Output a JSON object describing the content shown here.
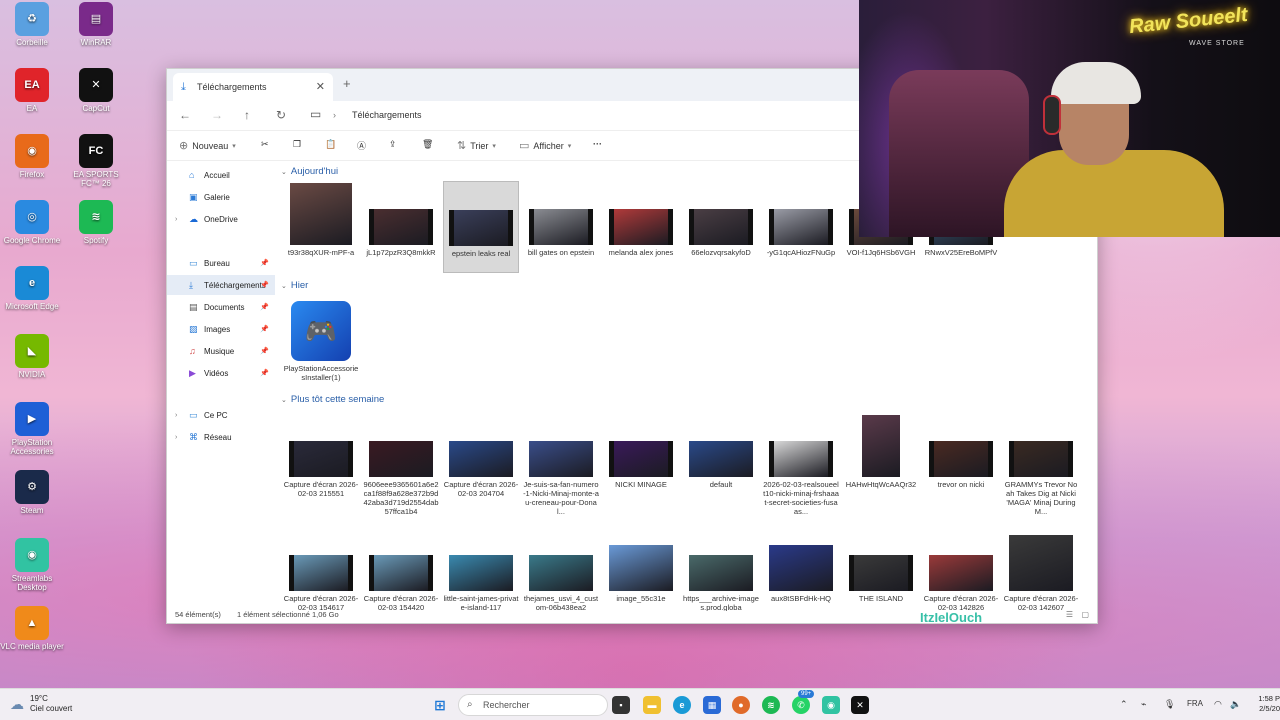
{
  "desktop": {
    "icons": [
      {
        "label": "Corbeille",
        "icon": "recycle-bin-icon"
      },
      {
        "label": "WinRAR",
        "icon": "winrar-icon"
      },
      {
        "label": "EA",
        "icon": "ea-icon"
      },
      {
        "label": "CapCut",
        "icon": "capcut-icon"
      },
      {
        "label": "Firefox",
        "icon": "firefox-icon"
      },
      {
        "label": "EA SPORTS FC™ 26",
        "icon": "easports-fc-icon"
      },
      {
        "label": "Google Chrome",
        "icon": "chrome-icon"
      },
      {
        "label": "Spotify",
        "icon": "spotify-icon"
      },
      {
        "label": "Microsoft Edge",
        "icon": "edge-icon"
      },
      {
        "label": "NVIDIA",
        "icon": "nvidia-icon"
      },
      {
        "label": "PlayStation Accessories",
        "icon": "playstation-accessories-icon"
      },
      {
        "label": "Steam",
        "icon": "steam-icon"
      },
      {
        "label": "Streamlabs Desktop",
        "icon": "streamlabs-icon"
      },
      {
        "label": "VLC media player",
        "icon": "vlc-icon"
      }
    ]
  },
  "explorer": {
    "tab_title": "Téléchargements",
    "breadcrumb": "Téléchargements",
    "toolbar": {
      "new_label": "Nouveau",
      "sort_label": "Trier",
      "view_label": "Afficher",
      "more_label": "···"
    },
    "sidebar": [
      {
        "label": "Accueil",
        "icon": "home-icon"
      },
      {
        "label": "Galerie",
        "icon": "gallery-icon"
      },
      {
        "label": "OneDrive",
        "icon": "onedrive-icon"
      },
      {
        "label": "Bureau",
        "icon": "desktop-folder-icon"
      },
      {
        "label": "Téléchargements",
        "icon": "download-icon"
      },
      {
        "label": "Documents",
        "icon": "documents-icon"
      },
      {
        "label": "Images",
        "icon": "images-icon"
      },
      {
        "label": "Musique",
        "icon": "music-icon"
      },
      {
        "label": "Vidéos",
        "icon": "videos-icon"
      },
      {
        "label": "Ce PC",
        "icon": "pc-icon"
      },
      {
        "label": "Réseau",
        "icon": "network-icon"
      }
    ],
    "groups": {
      "today": "Aujourd'hui",
      "yesterday": "Hier",
      "earlier": "Plus tôt cette semaine"
    },
    "files_today": [
      {
        "name": "t93r38qXUR-mPF-a",
        "kind": "image",
        "color": "#6a4a44"
      },
      {
        "name": "jL1p72pzR3Q8mkkR",
        "kind": "video",
        "color": "#4a2e30"
      },
      {
        "name": "epstein leaks real",
        "kind": "video",
        "color": "#3a3f5a"
      },
      {
        "name": "bill gates on epstein",
        "kind": "video",
        "color": "#8a8c92"
      },
      {
        "name": "melanda alex jones",
        "kind": "video",
        "color": "#b03a3a"
      },
      {
        "name": "66elozvqrsakyfoD",
        "kind": "video",
        "color": "#4a3e44"
      },
      {
        "name": "-yG1qcAHiozFNuGp",
        "kind": "video",
        "color": "#9a9ca6"
      },
      {
        "name": "VOI-f1Jq6HSb6VGH",
        "kind": "video",
        "color": "#6a4a3c"
      },
      {
        "name": "RNwxV25EreBoMPfV",
        "kind": "video",
        "color": "#3a5a7a"
      }
    ],
    "files_yesterday": [
      {
        "name": "PlayStationAccessoriesInstaller(1)",
        "kind": "app",
        "color": "#1e5fd6"
      }
    ],
    "files_earlier_row1": [
      {
        "name": "Capture d'écran 2026-02-03 215551",
        "kind": "video",
        "color": "#2a2a3a"
      },
      {
        "name": "9606eee9365601a6e2ca1f88f9a628e372b9d42aba3d719d2554dab57ffca1b4",
        "kind": "image",
        "color": "#3a1a22"
      },
      {
        "name": "Capture d'écran 2026-02-03 204704",
        "kind": "image",
        "color": "#2a4a8a"
      },
      {
        "name": "Je-suis-sa-fan-numero-1-Nicki-Minaj-monte-au-creneau-pour-Donal...",
        "kind": "image",
        "color": "#3a4e8a"
      },
      {
        "name": "NICKI MINAGE",
        "kind": "video",
        "color": "#3a1a5a"
      },
      {
        "name": "default",
        "kind": "image",
        "color": "#2a4a8a"
      },
      {
        "name": "2026-02-03-realsoueelt10-nicki-minaj-frshaaat-secret-societies-fusaas...",
        "kind": "video",
        "color": "#d8d8d8"
      },
      {
        "name": "HAHwHtqWcAAQr32",
        "kind": "image",
        "color": "#5a3a4a"
      },
      {
        "name": "trevor on nicki",
        "kind": "video",
        "color": "#4a2a22"
      },
      {
        "name": "GRAMMYs Trevor Noah Takes Dig at Nicki 'MAGA' Minaj During M...",
        "kind": "video",
        "color": "#3a2a22"
      }
    ],
    "files_earlier_row2": [
      {
        "name": "Capture d'écran 2026-02-03 154617",
        "kind": "video",
        "color": "#6a9ab8"
      },
      {
        "name": "Capture d'écran 2026-02-03 154420",
        "kind": "video",
        "color": "#6a9ab8"
      },
      {
        "name": "little-saint-james-private-island-117",
        "kind": "image",
        "color": "#3a8ab0"
      },
      {
        "name": "thejames_usvi_4_custom-06b438ea2",
        "kind": "image",
        "color": "#3a7a8a"
      },
      {
        "name": "image_55c31e",
        "kind": "image",
        "color": "#6a9ad8"
      },
      {
        "name": "https___archive-images.prod.globa",
        "kind": "image",
        "color": "#4a6a6a"
      },
      {
        "name": "aux8tSBFdHk-HQ",
        "kind": "image",
        "color": "#2a3a8a"
      },
      {
        "name": "THE ISLAND",
        "kind": "video",
        "color": "#3a3a3a"
      },
      {
        "name": "Capture d'écran 2026-02-03 142826",
        "kind": "image",
        "color": "#9a3a3a"
      },
      {
        "name": "Capture d'écran 2026-02-03 142607",
        "kind": "image",
        "color": "#3a3a3a"
      }
    ],
    "status": {
      "count": "54 élément(s)",
      "selection": "1 élément sélectionné  1,06 Go"
    }
  },
  "webcam": {
    "neon_sign": "Raw Soueelt",
    "neon_sub": "WAVE STORE"
  },
  "watermark": "ItzIelOuch",
  "taskbar": {
    "weather_temp": "19°C",
    "weather_desc": "Ciel couvert",
    "search_placeholder": "Rechercher",
    "lang": "FRA",
    "time": "1:58 P",
    "date": "2/5/20",
    "notif_badge": "99+"
  }
}
